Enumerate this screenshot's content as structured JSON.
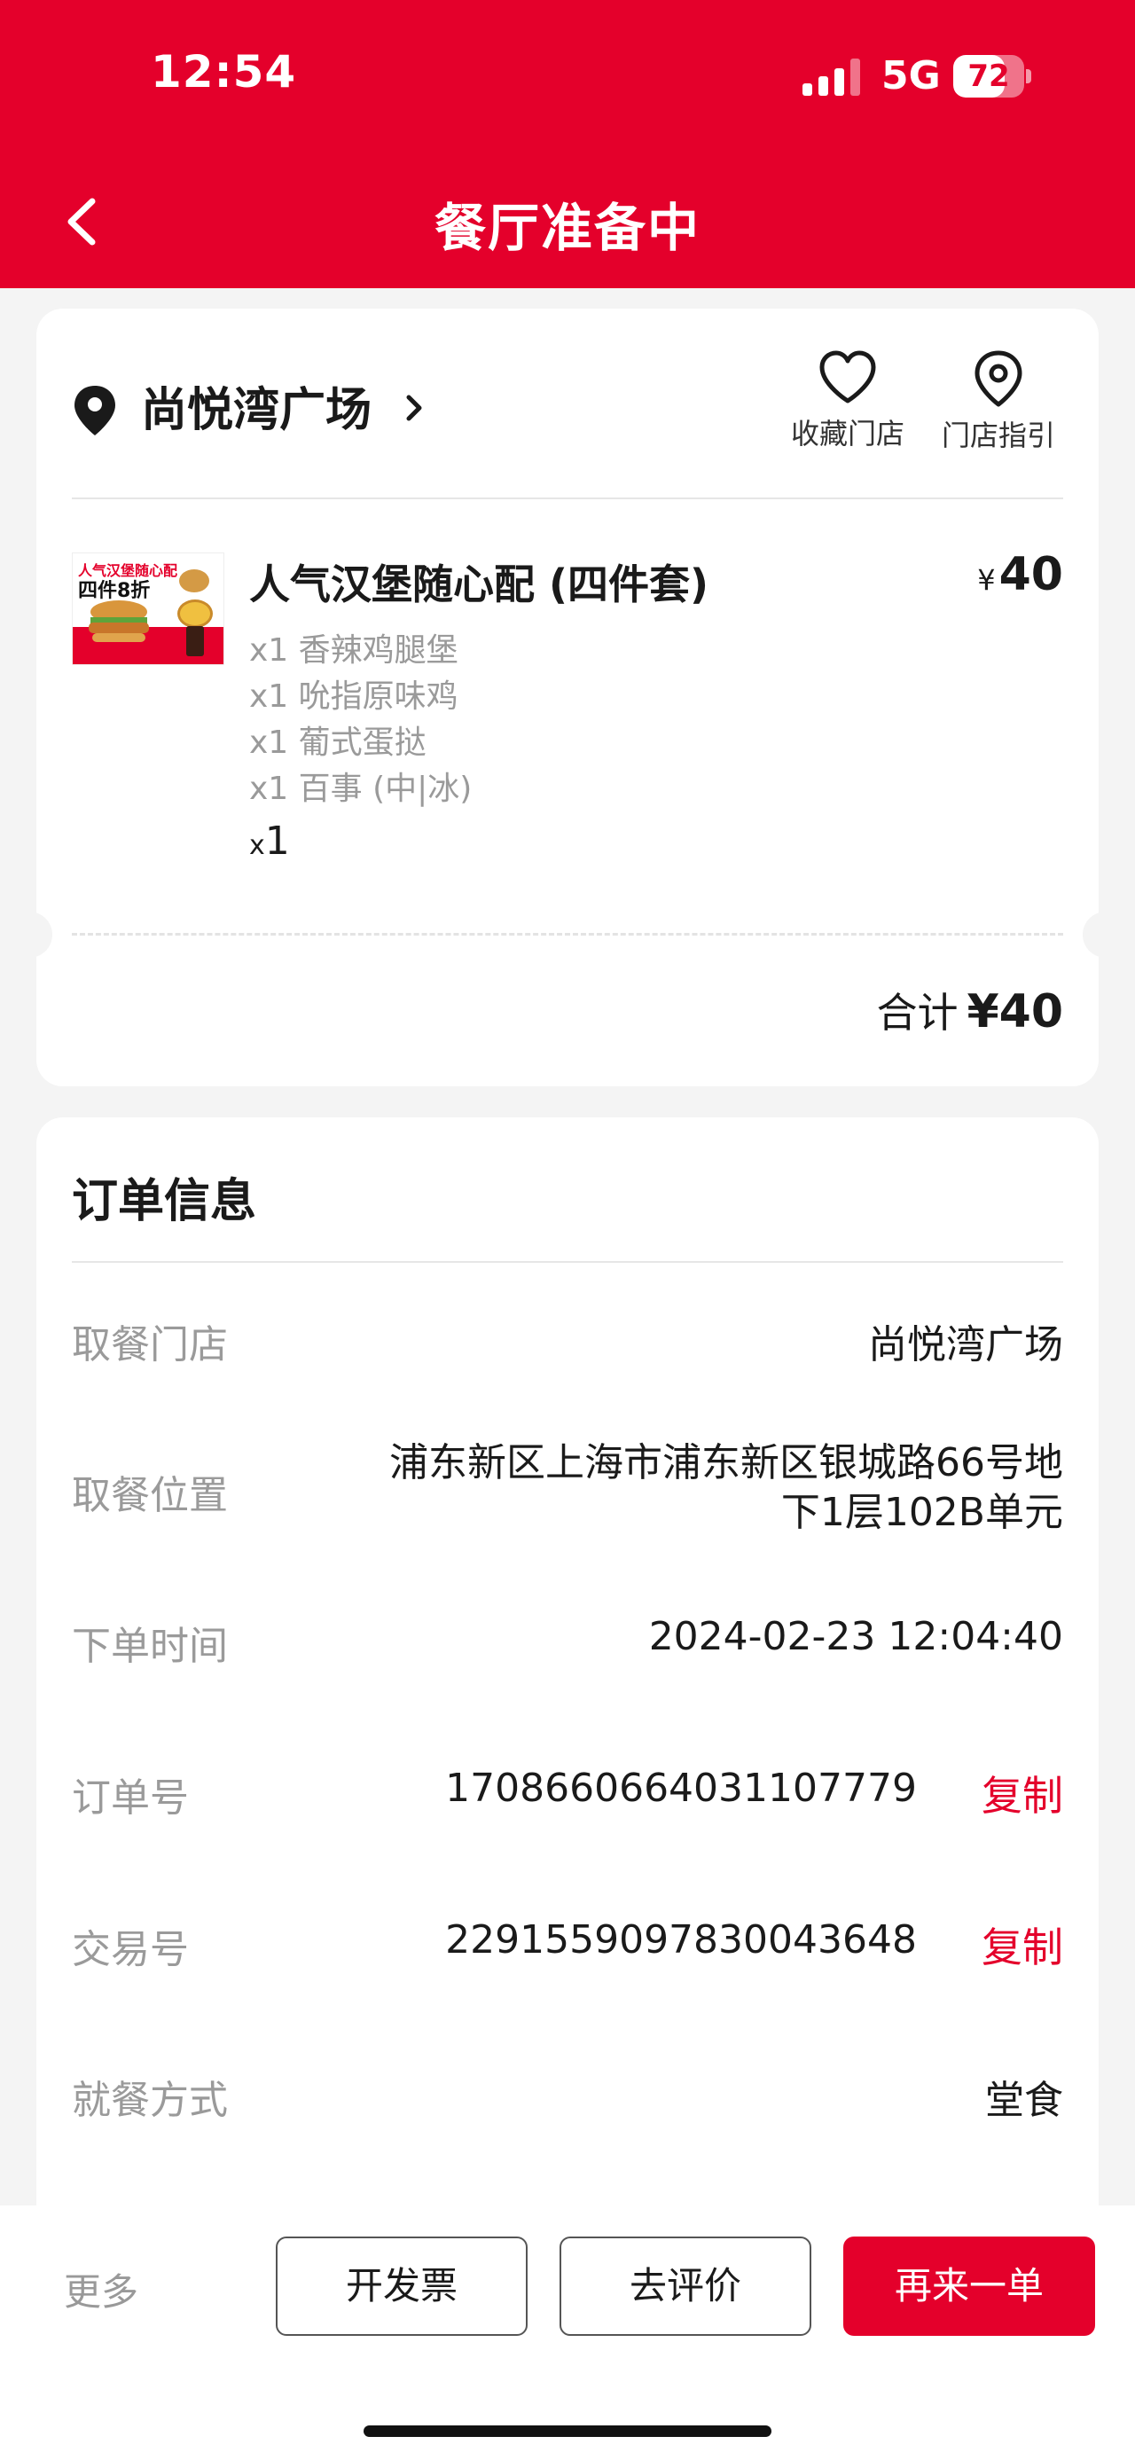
{
  "status_bar": {
    "time": "12:54",
    "network": "5G",
    "battery": "72",
    "battery_level": 0.72
  },
  "header": {
    "title": "餐厅准备中"
  },
  "store": {
    "name": "尚悦湾广场",
    "favorite_label": "收藏门店",
    "guide_label": "门店指引"
  },
  "product": {
    "image_tag_top": "人气汉堡随心配",
    "image_tag_main": "四件8折",
    "name": "人气汉堡随心配 (四件套)",
    "price_symbol": "¥",
    "price": "40",
    "items": [
      "x1 香辣鸡腿堡",
      "x1 吮指原味鸡",
      "x1 葡式蛋挞",
      "x1 百事 (中|冰)"
    ],
    "qty_prefix": "x",
    "qty": "1"
  },
  "total": {
    "label": "合计",
    "amount": "¥40"
  },
  "order_info": {
    "title": "订单信息",
    "rows": [
      {
        "label": "取餐门店",
        "value": "尚悦湾广场"
      },
      {
        "label": "取餐位置",
        "value": "浦东新区上海市浦东新区银城路66号地下1层102B单元"
      },
      {
        "label": "下单时间",
        "value": "2024-02-23 12:04:40"
      },
      {
        "label": "订单号",
        "value": "1708660664031107779",
        "action": "复制"
      },
      {
        "label": "交易号",
        "value": "2291559097830043648",
        "action": "复制"
      },
      {
        "label": "就餐方式",
        "value": "堂食"
      }
    ]
  },
  "bottom_bar": {
    "more": "更多",
    "invoice": "开发票",
    "review": "去评价",
    "reorder": "再来一单"
  },
  "colors": {
    "brand_red": "#e4002b",
    "background": "#f4f4f4"
  }
}
